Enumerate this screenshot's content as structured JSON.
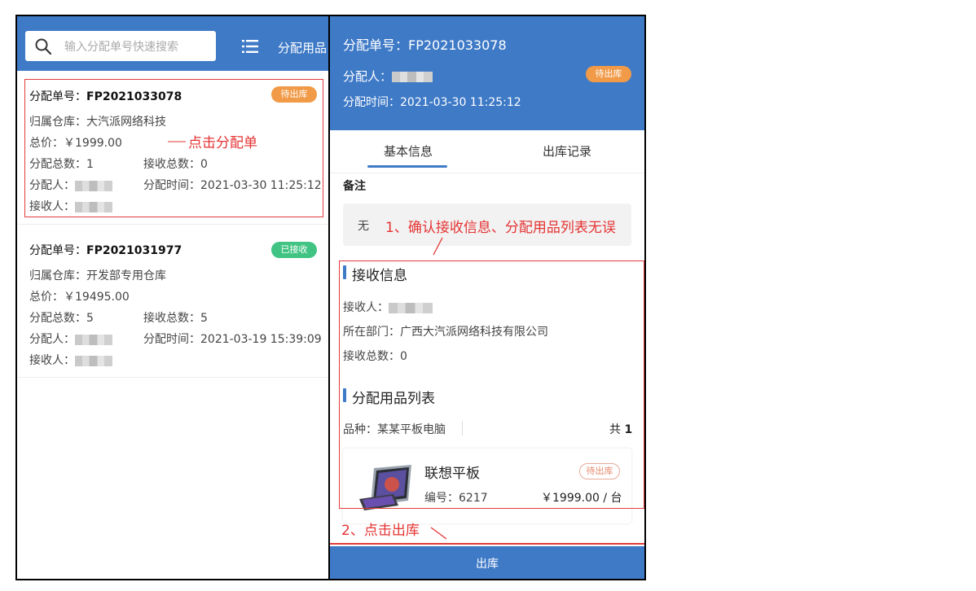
{
  "list": {
    "search_placeholder": "输入分配单号快速搜索",
    "category_label": "分配用品",
    "cards": [
      {
        "order_label": "分配单号：",
        "order_no": "FP2021033078",
        "status": "待出库",
        "warehouse": "归属仓库：大汽派网络科技",
        "total": "总价：￥1999.00",
        "alloc_total": "分配总数：1",
        "recv_total": "接收总数：0",
        "allocator_label": "分配人：",
        "alloc_time": "分配时间：2021-03-30 11:25:12",
        "receiver_label": "接收人："
      },
      {
        "order_label": "分配单号：",
        "order_no": "FP2021031977",
        "status": "已接收",
        "warehouse": "归属仓库：开发部专用仓库",
        "total": "总价：￥19495.00",
        "alloc_total": "分配总数：5",
        "recv_total": "接收总数：5",
        "allocator_label": "分配人：",
        "alloc_time": "分配时间：2021-03-19 15:39:09",
        "receiver_label": "接收人："
      }
    ]
  },
  "detail": {
    "order": "分配单号：FP2021033078",
    "allocator_label": "分配人：",
    "status": "待出库",
    "alloc_time": "分配时间：2021-03-30 11:25:12",
    "tabs": [
      "基本信息",
      "出库记录"
    ],
    "remark_label": "备注",
    "remark_value": "无",
    "receive_title": "接收信息",
    "receiver_label": "接收人：",
    "department": "所在部门：广西大汽派网络科技有限公司",
    "recv_total": "接收总数：0",
    "items_title": "分配用品列表",
    "category": "品种：某某平板电脑",
    "count_prefix": "共",
    "count": "1",
    "item": {
      "name": "联想平板",
      "status": "待出库",
      "code": "编号：6217",
      "price": "￥1999.00 / 台"
    },
    "button_label": "出库"
  },
  "annotations": {
    "click_order": "点击分配单",
    "confirm": "1、确认接收信息、分配用品列表无误",
    "click_out": "2、点击出库"
  },
  "colors": {
    "brand": "#3f7ac7",
    "pending": "#f19a47",
    "received": "#41c483",
    "annotation": "#e53333"
  }
}
